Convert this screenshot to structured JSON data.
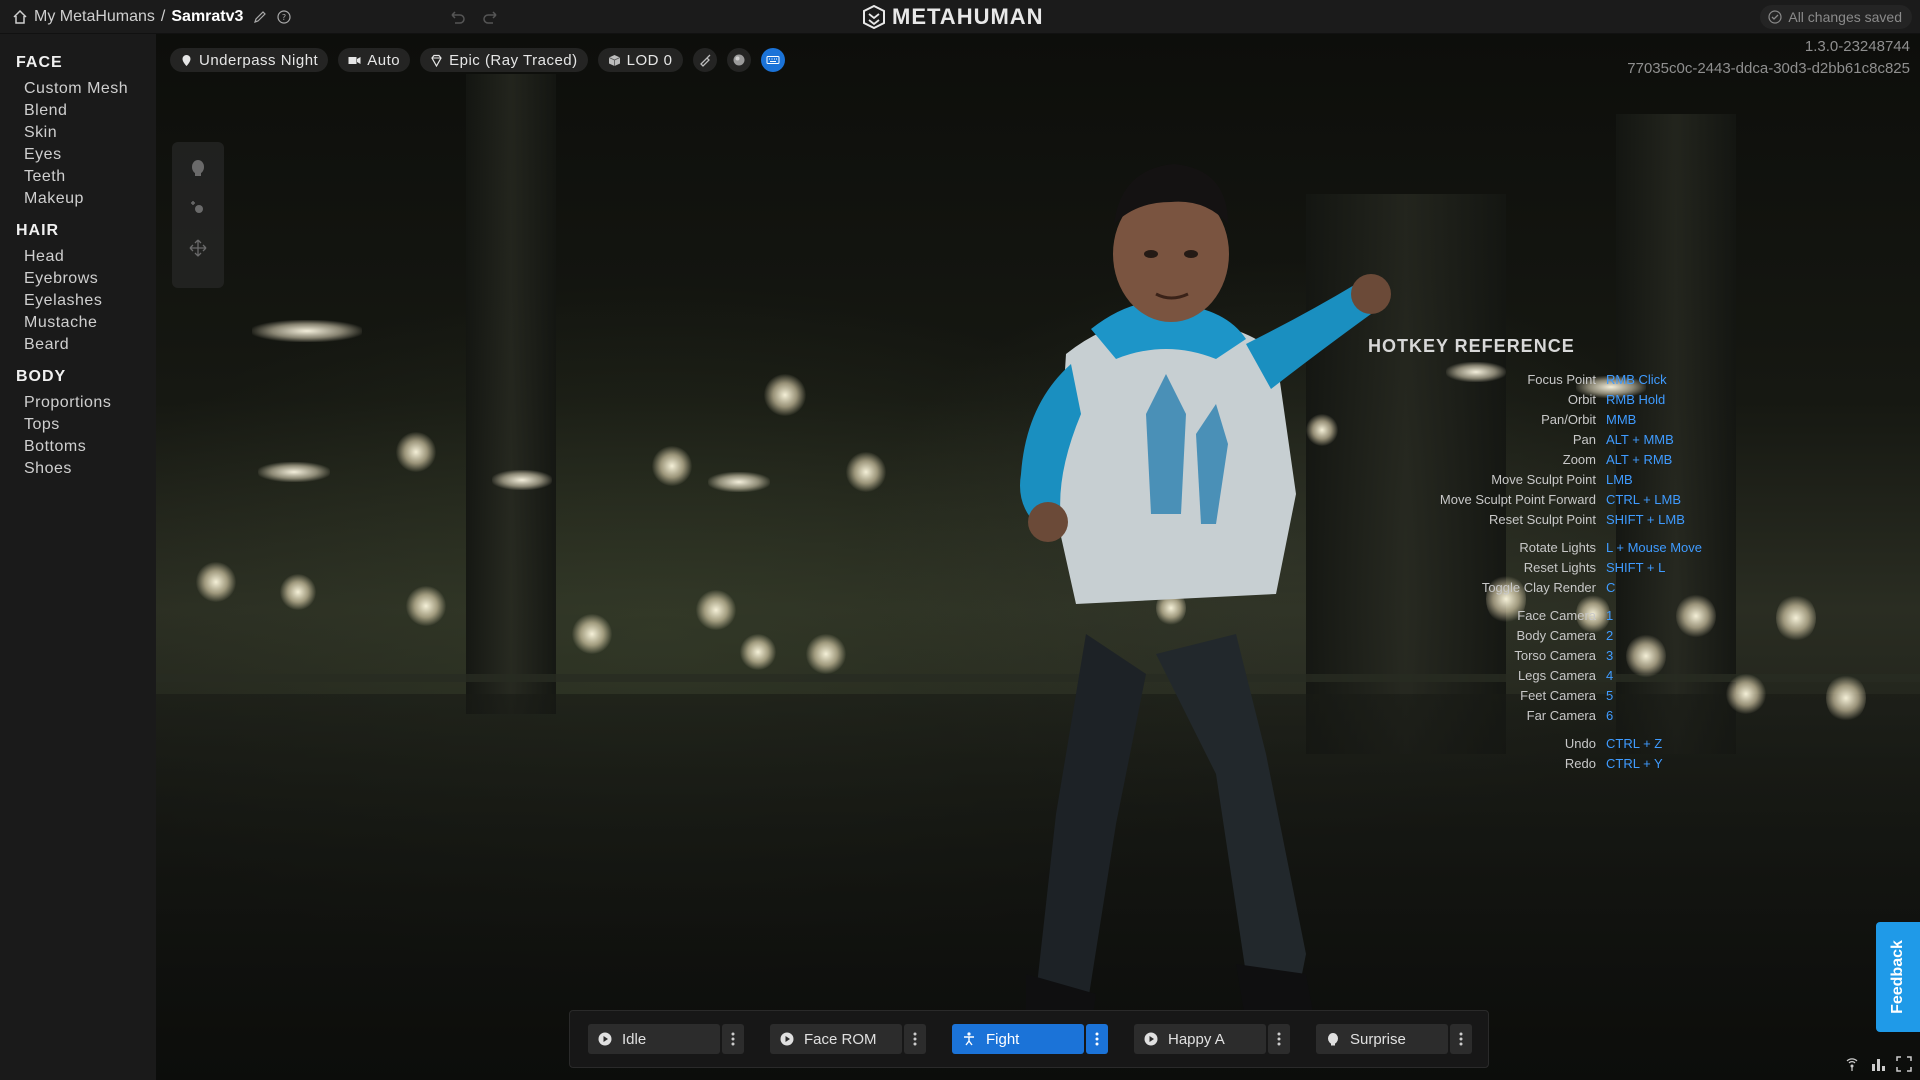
{
  "header": {
    "breadcrumb_root": "My MetaHumans",
    "breadcrumb_sep": "/",
    "breadcrumb_current": "Samratv3",
    "brand": "METAHUMAN",
    "save_status": "All changes saved"
  },
  "sidebar": {
    "groups": [
      {
        "title": "FACE",
        "items": [
          "Custom Mesh",
          "Blend",
          "Skin",
          "Eyes",
          "Teeth",
          "Makeup"
        ]
      },
      {
        "title": "HAIR",
        "items": [
          "Head",
          "Eyebrows",
          "Eyelashes",
          "Mustache",
          "Beard"
        ]
      },
      {
        "title": "BODY",
        "items": [
          "Proportions",
          "Tops",
          "Bottoms",
          "Shoes"
        ]
      }
    ]
  },
  "viewport": {
    "lighting": "Underpass Night",
    "camera": "Auto",
    "quality": "Epic (Ray Traced)",
    "lod": "LOD 0",
    "version": "1.3.0-23248744",
    "build_id": "77035c0c-2443-ddca-30d3-d2bb61c8c825"
  },
  "hotkeys": {
    "title": "HOTKEY REFERENCE",
    "rows": [
      {
        "label": "Focus Point",
        "key": "RMB Click"
      },
      {
        "label": "Orbit",
        "key": "RMB Hold"
      },
      {
        "label": "Pan/Orbit",
        "key": "MMB"
      },
      {
        "label": "Pan",
        "key": "ALT + MMB"
      },
      {
        "label": "Zoom",
        "key": "ALT + RMB"
      },
      {
        "label": "Move Sculpt Point",
        "key": "LMB"
      },
      {
        "label": "Move Sculpt Point Forward",
        "key": "CTRL + LMB"
      },
      {
        "label": "Reset Sculpt Point",
        "key": "SHIFT + LMB"
      },
      {
        "label": "Rotate Lights",
        "key": "L + Mouse Move"
      },
      {
        "label": "Reset Lights",
        "key": "SHIFT + L"
      },
      {
        "label": "Toggle Clay Render",
        "key": "C"
      },
      {
        "label": "Face Camera",
        "key": "1"
      },
      {
        "label": "Body Camera",
        "key": "2"
      },
      {
        "label": "Torso Camera",
        "key": "3"
      },
      {
        "label": "Legs Camera",
        "key": "4"
      },
      {
        "label": "Feet Camera",
        "key": "5"
      },
      {
        "label": "Far Camera",
        "key": "6"
      },
      {
        "label": "Undo",
        "key": "CTRL + Z"
      },
      {
        "label": "Redo",
        "key": "CTRL + Y"
      }
    ]
  },
  "animations": [
    {
      "label": "Idle",
      "icon": "play-icon",
      "active": false
    },
    {
      "label": "Face ROM",
      "icon": "play-icon",
      "active": false
    },
    {
      "label": "Fight",
      "icon": "figure-icon",
      "active": true
    },
    {
      "label": "Happy A",
      "icon": "play-icon",
      "active": false
    },
    {
      "label": "Surprise",
      "icon": "face-icon",
      "active": false
    }
  ],
  "feedback": "Feedback",
  "colors": {
    "accent": "#1b73d8",
    "hotkey": "#3f9bff",
    "feedback": "#1f9ae8"
  }
}
